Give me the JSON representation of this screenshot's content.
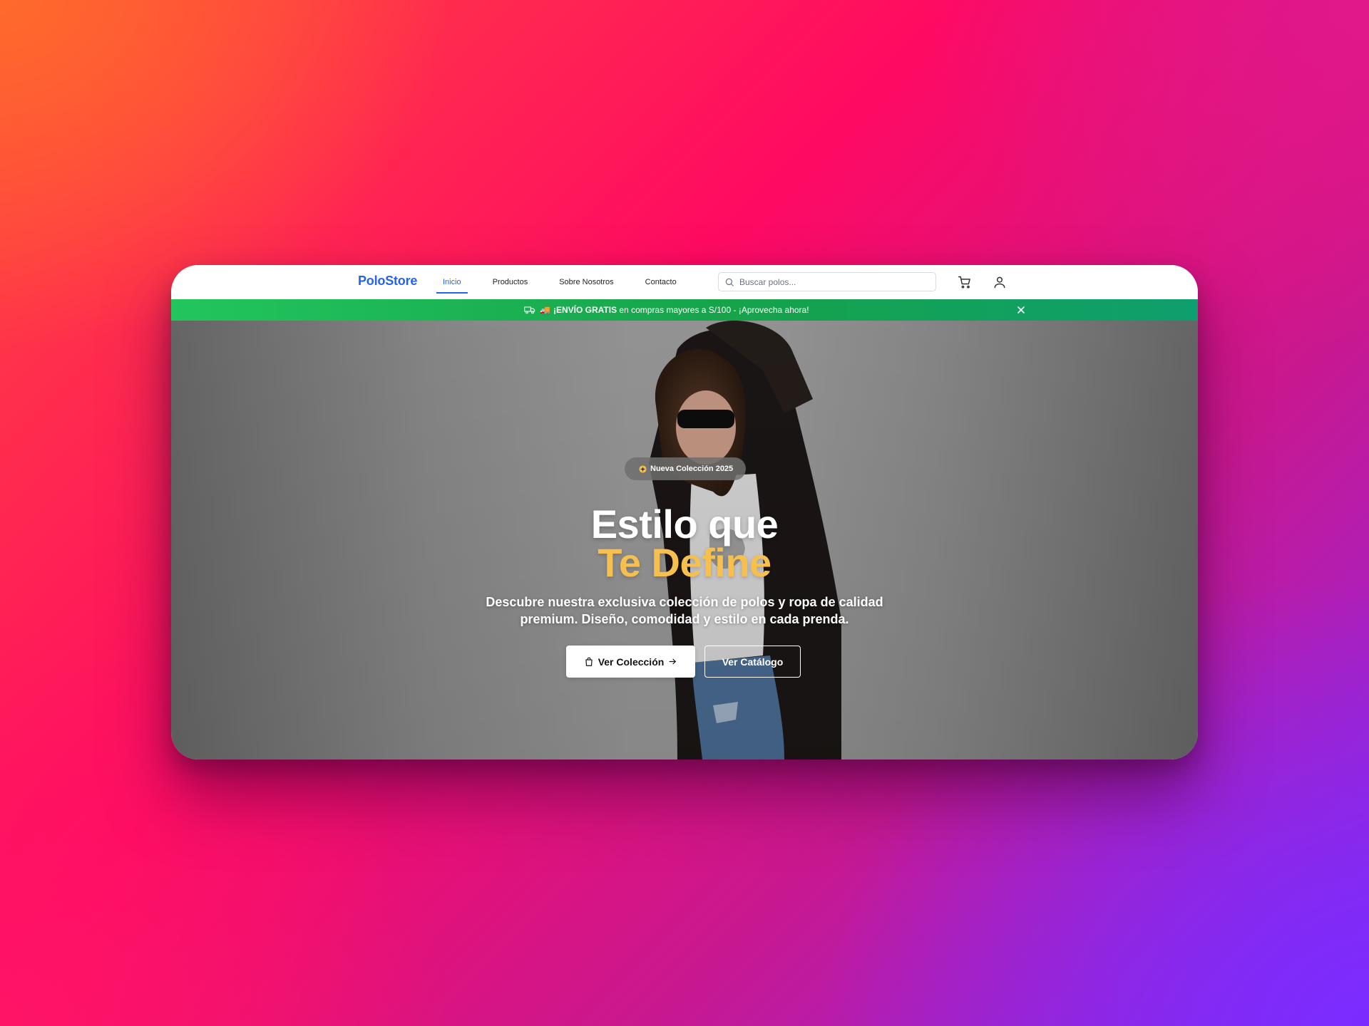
{
  "header": {
    "logo": "PoloStore",
    "nav": [
      {
        "label": "Inicio",
        "active": true
      },
      {
        "label": "Productos",
        "active": false
      },
      {
        "label": "Sobre Nosotros",
        "active": false
      },
      {
        "label": "Contacto",
        "active": false
      }
    ],
    "search": {
      "placeholder": "Buscar polos...",
      "value": ""
    },
    "icons": {
      "search": "search-icon",
      "cart": "cart-icon",
      "user": "user-icon"
    }
  },
  "banner": {
    "icon": "truck-icon",
    "emoji": "🚚",
    "bold": "¡ENVÍO GRATIS",
    "text": " en compras mayores a S/100 - ¡Aprovecha ahora!",
    "close_icon": "close-icon"
  },
  "hero": {
    "badge": "Nueva Colección 2025",
    "badge_icon": "sparkle-icon",
    "title_line1": "Estilo que",
    "title_line2": "Te Define",
    "subtitle": "Descubre nuestra exclusiva colección de polos y ropa de calidad premium. Diseño, comodidad y estilo en cada prenda.",
    "primary_button": "Ver Colección",
    "secondary_button": "Ver Catálogo"
  },
  "colors": {
    "brand": "#2563eb",
    "banner": "#22c55e",
    "accent": "#f7c04e"
  }
}
